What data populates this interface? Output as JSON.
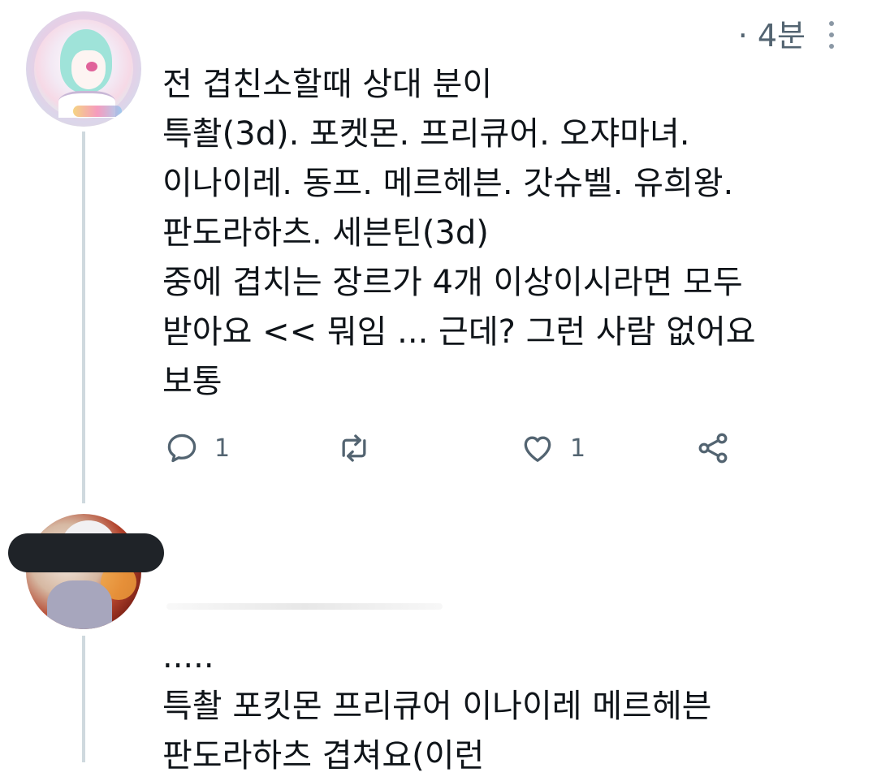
{
  "tweet1": {
    "timestamp": "· 4분",
    "lines": [
      "전 겹친소할때 상대 분이",
      "특촬(3d). 포켓몬. 프리큐어. 오쟈마녀.",
      "이나이레. 동프. 메르헤븐. 갓슈벨. 유희왕.",
      "판도라하츠. 세븐틴(3d)",
      "중에 겹치는 장르가 4개 이상이시라면 모두",
      "받아요 << 뭐임 ... 근데? 그런 사람 없어요",
      "보통"
    ],
    "actions": {
      "reply_count": "1",
      "retweet_count": "",
      "like_count": "1"
    }
  },
  "tweet2": {
    "lines": [
      ".....",
      "특촬 포킷몬 프리큐어 이나이레 메르헤븐",
      "판도라하츠 겹쳐요(이런"
    ]
  },
  "icons": {
    "more": "more-vertical-icon",
    "reply": "reply-icon",
    "retweet": "retweet-icon",
    "like": "heart-icon",
    "share": "share-icon"
  },
  "colors": {
    "text": "#0f1419",
    "muted": "#536471",
    "thread_line": "#cfd9de",
    "redaction": "#1f2328"
  }
}
